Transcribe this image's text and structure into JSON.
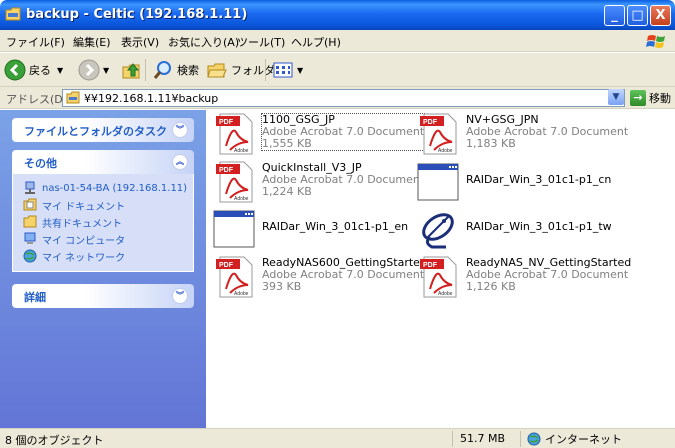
{
  "window": {
    "title": "backup - Celtic (192.168.1.11)",
    "buttons": {
      "minimize": "_",
      "maximize": "□",
      "close": "X"
    }
  },
  "menu": [
    "ファイル(F)",
    "編集(E)",
    "表示(V)",
    "お気に入り(A)",
    "ツール(T)",
    "ヘルプ(H)"
  ],
  "toolbar": {
    "back": "戻る",
    "search": "検索",
    "folders": "フォルダ"
  },
  "address": {
    "label": "アドレス(D)",
    "value": "¥¥192.168.1.11¥backup",
    "go": "移動"
  },
  "tasks": {
    "file_tasks_title": "ファイルとフォルダのタスク",
    "other_title": "その他",
    "other_items": [
      {
        "label": "nas-01-54-BA (192.168.1.11)",
        "icon": "network-computer-icon"
      },
      {
        "label": "マイ ドキュメント",
        "icon": "my-documents-icon"
      },
      {
        "label": "共有ドキュメント",
        "icon": "shared-documents-icon"
      },
      {
        "label": "マイ コンピュータ",
        "icon": "my-computer-icon"
      },
      {
        "label": "マイ ネットワーク",
        "icon": "my-network-icon"
      }
    ],
    "details_title": "詳細"
  },
  "files": [
    {
      "name": "1100_GSG_JP",
      "type": "Adobe Acrobat 7.0 Document",
      "size": "1,555 KB",
      "icon": "pdf-icon"
    },
    {
      "name": "NV+GSG_JPN",
      "type": "Adobe Acrobat 7.0 Document",
      "size": "1,183 KB",
      "icon": "pdf-icon"
    },
    {
      "name": "QuickInstall_V3_JP",
      "type": "Adobe Acrobat 7.0 Document",
      "size": "1,224 KB",
      "icon": "pdf-icon"
    },
    {
      "name": "RAIDar_Win_3_01c1-p1_cn",
      "icon": "application-window-icon"
    },
    {
      "name": "RAIDar_Win_3_01c1-p1_en",
      "icon": "application-window-icon"
    },
    {
      "name": "RAIDar_Win_3_01c1-p1_tw",
      "icon": "satellite-dish-icon"
    },
    {
      "name": "ReadyNAS600_GettingStarted",
      "type": "Adobe Acrobat 7.0 Document",
      "size": "393 KB",
      "icon": "pdf-icon"
    },
    {
      "name": "ReadyNAS_NV_GettingStarted",
      "type": "Adobe Acrobat 7.0 Document",
      "size": "1,126 KB",
      "icon": "pdf-icon"
    }
  ],
  "status": {
    "objects": "8 個のオブジェクト",
    "size": "51.7 MB",
    "zone": "インターネット"
  },
  "colors": {
    "titlebar": "#0a5fe0",
    "task_pane": "#6f8fe0",
    "pdf_red": "#d21f1f",
    "link_blue": "#215dc6"
  }
}
